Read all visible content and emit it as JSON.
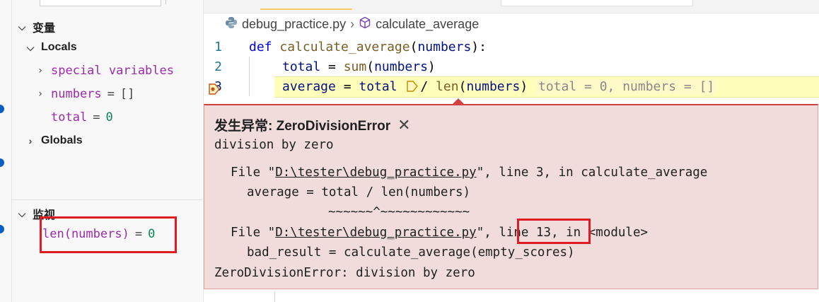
{
  "sidebar": {
    "variables_title": "变量",
    "locals_label": "Locals",
    "special_variables": "special variables",
    "numbers_name": "numbers",
    "numbers_value": "[]",
    "total_name": "total",
    "total_value": "0",
    "globals_label": "Globals",
    "watch_title": "监视",
    "watch_expr": "len(numbers)",
    "watch_value": "0",
    "equals": "="
  },
  "breadcrumb": {
    "file": "debug_practice.py",
    "symbol": "calculate_average"
  },
  "code": {
    "line1_no": "1",
    "line1_def": "def",
    "line1_fn": "calculate_average",
    "line1_param": "numbers",
    "line2_no": "2",
    "line2_total": "total",
    "line2_sum": "sum",
    "line2_arg": "numbers",
    "line3_no": "3",
    "line3_avg": "average",
    "line3_total": "total",
    "line3_len": "len",
    "line3_arg": "numbers",
    "line3_inline": "total = 0, numbers = []"
  },
  "exception": {
    "title": "发生异常: ZeroDivisionError",
    "message": "division by zero",
    "tb1_prefix": "File \"",
    "tb1_path": "D:\\tester\\debug_practice.py",
    "tb1_suffix": "\", line 3, in calculate_average",
    "tb1_code": "average = total / len(numbers)",
    "tb1_carets": "~~~~~~^~~~~~~~~~~~~",
    "tb2_prefix": "File \"",
    "tb2_path": "D:\\tester\\debug_practice.py",
    "tb2_mid": "\", ",
    "tb2_line": "line 13,",
    "tb2_suffix": " in <module>",
    "tb2_code": "bad_result = calculate_average(empty_scores)",
    "final": "ZeroDivisionError: division by zero"
  },
  "colors": {
    "highlight_box": "#e01b24",
    "exception_bg": "#f1dcdc",
    "current_line": "#ffffbb"
  }
}
